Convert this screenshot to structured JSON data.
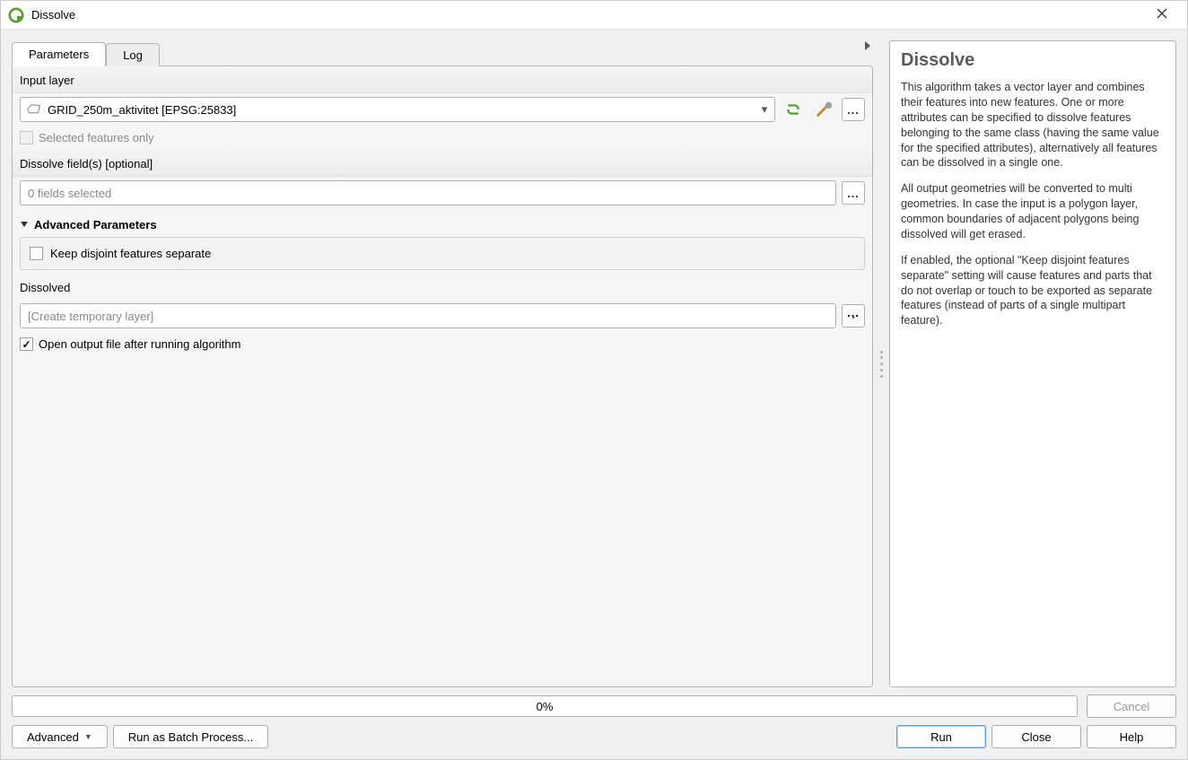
{
  "titlebar": {
    "title": "Dissolve"
  },
  "tabs": {
    "parameters": "Parameters",
    "log": "Log"
  },
  "params": {
    "input_layer_label": "Input layer",
    "input_layer_value": "GRID_250m_aktivitet [EPSG:25833]",
    "selected_only_label": "Selected features only",
    "dissolve_fields_label": "Dissolve field(s) [optional]",
    "dissolve_fields_value": "0 fields selected",
    "advanced_header": "Advanced Parameters",
    "keep_disjoint_label": "Keep disjoint features separate",
    "dissolved_label": "Dissolved",
    "dissolved_placeholder": "[Create temporary layer]",
    "open_output_label": "Open output file after running algorithm"
  },
  "help": {
    "title": "Dissolve",
    "p1": "This algorithm takes a vector layer and combines their features into new features. One or more attributes can be specified to dissolve features belonging to the same class (having the same value for the specified attributes), alternatively all features can be dissolved in a single one.",
    "p2": "All output geometries will be converted to multi geometries. In case the input is a polygon layer, common boundaries of adjacent polygons being dissolved will get erased.",
    "p3": "If enabled, the optional \"Keep disjoint features separate\" setting will cause features and parts that do not overlap or touch to be exported as separate features (instead of parts of a single multipart feature)."
  },
  "progress": {
    "text": "0%"
  },
  "buttons": {
    "cancel": "Cancel",
    "advanced": "Advanced",
    "batch": "Run as Batch Process...",
    "run": "Run",
    "close": "Close",
    "help": "Help"
  }
}
